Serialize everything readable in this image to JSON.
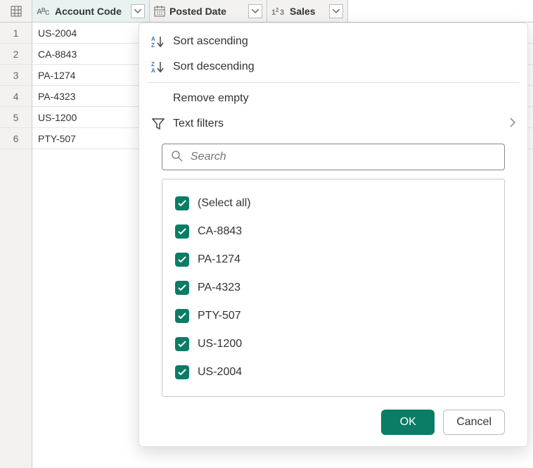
{
  "columns": [
    {
      "label": "Account Code",
      "type": "text"
    },
    {
      "label": "Posted Date",
      "type": "date"
    },
    {
      "label": "Sales",
      "type": "number"
    }
  ],
  "rows": [
    {
      "n": "1",
      "account": "US-2004"
    },
    {
      "n": "2",
      "account": "CA-8843"
    },
    {
      "n": "3",
      "account": "PA-1274"
    },
    {
      "n": "4",
      "account": "PA-4323"
    },
    {
      "n": "5",
      "account": "US-1200"
    },
    {
      "n": "6",
      "account": "PTY-507"
    }
  ],
  "menu": {
    "sort_asc": "Sort ascending",
    "sort_desc": "Sort descending",
    "remove_empty": "Remove empty",
    "text_filters": "Text filters"
  },
  "search": {
    "placeholder": "Search"
  },
  "filter_values": [
    "(Select all)",
    "CA-8843",
    "PA-1274",
    "PA-4323",
    "PTY-507",
    "US-1200",
    "US-2004"
  ],
  "buttons": {
    "ok": "OK",
    "cancel": "Cancel"
  }
}
